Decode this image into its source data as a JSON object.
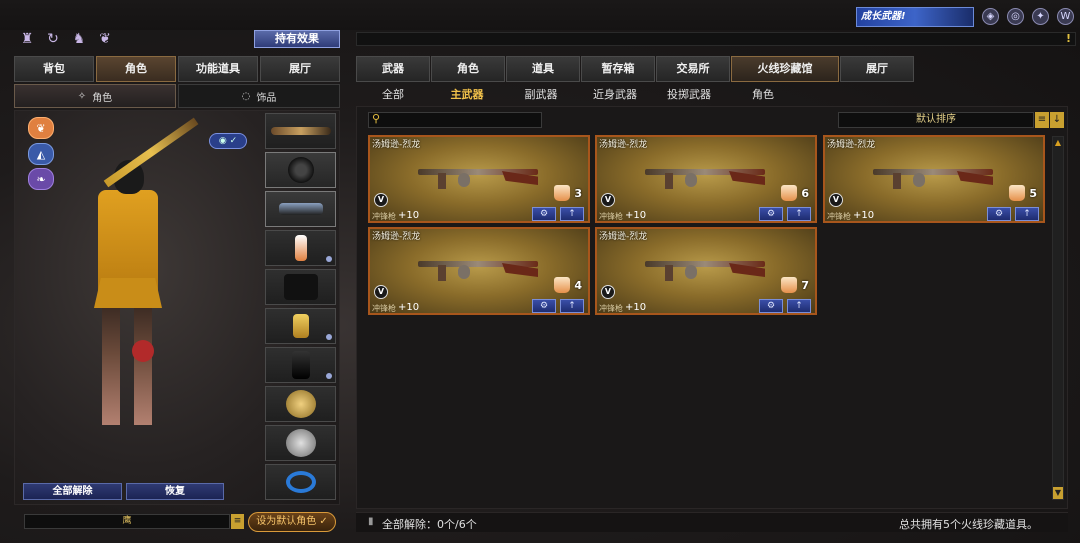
{
  "header": {
    "effect_button": "持有效果",
    "banner_text": "成长武器!",
    "notification_mark": "!"
  },
  "left": {
    "tabs": [
      "背包",
      "角色",
      "功能道具",
      "展厅"
    ],
    "subtabs": [
      "角色",
      "饰品"
    ],
    "unequip_all": "全部解除",
    "restore": "恢复",
    "character_name": "鹰",
    "set_default": "设为默认角色"
  },
  "right": {
    "tabs": [
      "武器",
      "角色",
      "道具",
      "暂存箱",
      "交易所",
      "火线珍藏馆",
      "展厅"
    ],
    "subtabs": [
      "全部",
      "主武器",
      "副武器",
      "近身武器",
      "投掷武器",
      "角色"
    ],
    "sort_label": "默认排序",
    "cards": [
      {
        "name": "汤姆逊-烈龙",
        "count": "3",
        "type": "冲锋枪",
        "value": "+10"
      },
      {
        "name": "汤姆逊-烈龙",
        "count": "6",
        "type": "冲锋枪",
        "value": "+10"
      },
      {
        "name": "汤姆逊-烈龙",
        "count": "5",
        "type": "冲锋枪",
        "value": "+10"
      },
      {
        "name": "汤姆逊-烈龙",
        "count": "4",
        "type": "冲锋枪",
        "value": "+10"
      },
      {
        "name": "汤姆逊-烈龙",
        "count": "7",
        "type": "冲锋枪",
        "value": "+10"
      }
    ]
  },
  "footer": {
    "left_text": "全部解除：0个/6个",
    "right_text": "总共拥有5个火线珍藏道具。"
  },
  "icons": {
    "v_badge": "V",
    "upgrade": "↑",
    "gear": "⚙",
    "search": "🔍"
  },
  "colors": {
    "accent_gold": "#f2c24a",
    "card_border": "#a8561c",
    "button_blue": "#2f3a72"
  }
}
